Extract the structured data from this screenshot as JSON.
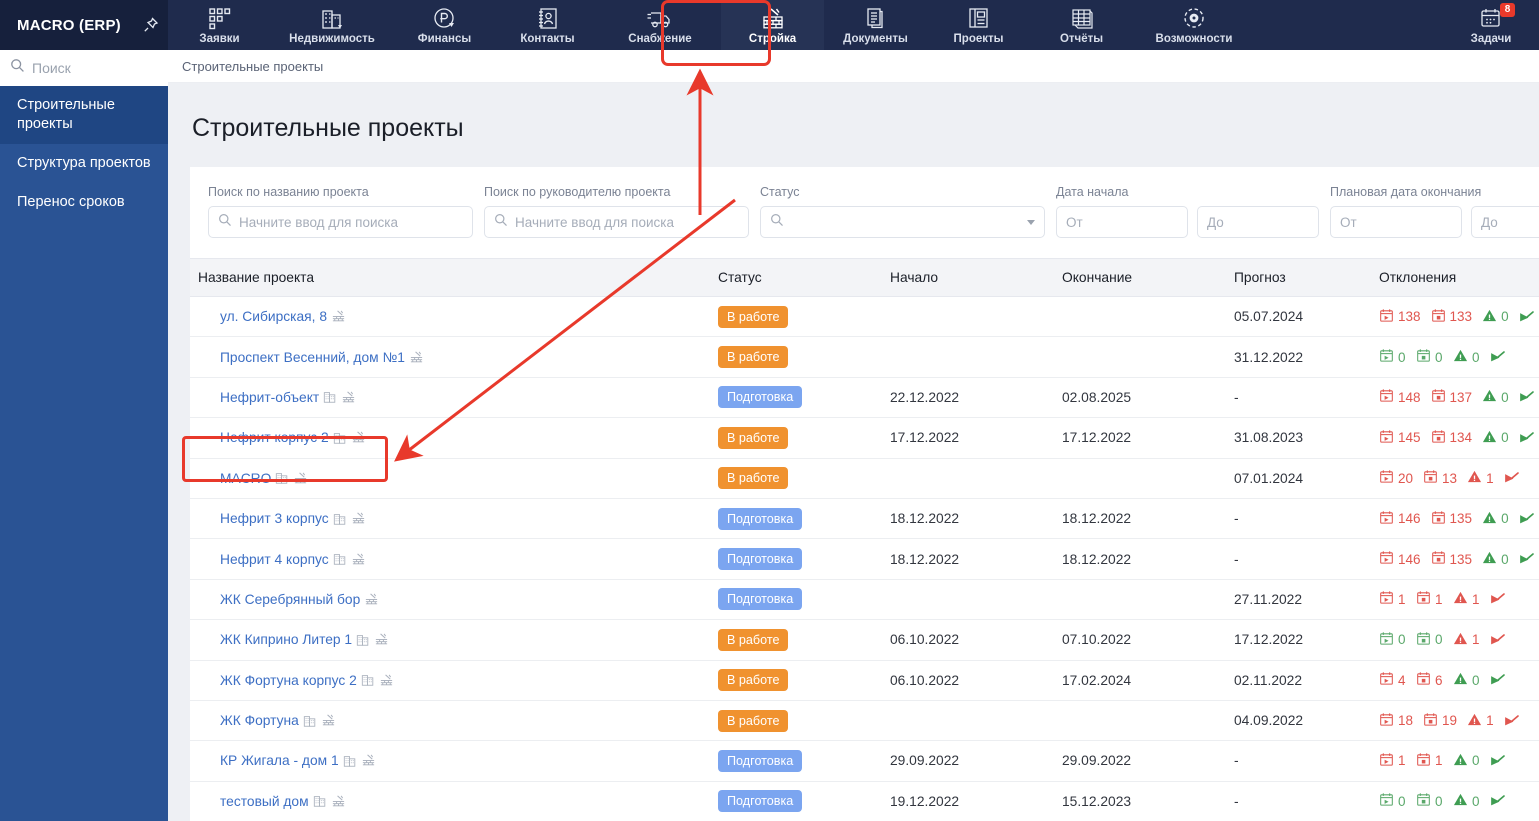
{
  "brand": {
    "title": "MACRO (ERP)",
    "pin_icon": "pin-icon"
  },
  "topnav": {
    "items": [
      {
        "label": "Заявки",
        "icon": "requests-icon"
      },
      {
        "label": "Недвижимость",
        "icon": "realestate-icon"
      },
      {
        "label": "Финансы",
        "icon": "finance-ruble-icon"
      },
      {
        "label": "Контакты",
        "icon": "contacts-icon"
      },
      {
        "label": "Снабжение",
        "icon": "supply-truck-icon"
      },
      {
        "label": "Стройка",
        "icon": "construction-icon",
        "active": true
      },
      {
        "label": "Документы",
        "icon": "documents-icon"
      },
      {
        "label": "Проекты",
        "icon": "projects-icon"
      },
      {
        "label": "Отчёты",
        "icon": "reports-icon"
      },
      {
        "label": "Возможности",
        "icon": "features-gear-icon"
      }
    ],
    "tasks": {
      "label": "Задачи",
      "icon": "calendar-tasks-icon",
      "badge": "8"
    }
  },
  "sidebar": {
    "search_placeholder": "Поиск",
    "items": [
      {
        "label": "Строительные проекты",
        "active": true
      },
      {
        "label": "Структура проектов",
        "active": false
      },
      {
        "label": "Перенос сроков",
        "active": false
      }
    ]
  },
  "breadcrumb": "Строительные проекты",
  "page_title": "Строительные проекты",
  "filters": [
    {
      "label": "Поиск по названию проекта",
      "placeholder": "Начните ввод для поиска",
      "icon": "search-icon"
    },
    {
      "label": "Поиск по руководителю проекта",
      "placeholder": "Начните ввод для поиска",
      "icon": "search-icon"
    },
    {
      "label": "Статус",
      "placeholder": "",
      "icon": "search-icon",
      "dropdown": true
    },
    {
      "label": "Дата начала",
      "from_placeholder": "От",
      "to_placeholder": "До"
    },
    {
      "label": "Плановая дата окончания",
      "from_placeholder": "От",
      "to_placeholder": "До"
    }
  ],
  "table": {
    "columns": [
      "Название проекта",
      "Статус",
      "Начало",
      "Окончание",
      "Прогноз",
      "Отклонения"
    ],
    "rows": [
      {
        "name": "ул. Сибирская, 8",
        "icons": [
          "crane-icon"
        ],
        "status": "В работе",
        "status_kind": "work",
        "start": "",
        "end": "",
        "forecast": "05.07.2024",
        "dev": [
          {
            "v": "138",
            "c": "red"
          },
          {
            "v": "133",
            "c": "red"
          },
          {
            "v": "0",
            "c": "green"
          }
        ]
      },
      {
        "name": "Проспект Весенний, дом №1",
        "icons": [
          "crane-icon"
        ],
        "status": "В работе",
        "status_kind": "work",
        "start": "",
        "end": "",
        "forecast": "31.12.2022",
        "dev": [
          {
            "v": "0",
            "c": "green"
          },
          {
            "v": "0",
            "c": "green"
          },
          {
            "v": "0",
            "c": "green"
          }
        ]
      },
      {
        "name": "Нефрит-объект",
        "icons": [
          "building-icon",
          "crane-icon"
        ],
        "status": "Подготовка",
        "status_kind": "prep",
        "start": "22.12.2022",
        "end": "02.08.2025",
        "forecast": "-",
        "dev": [
          {
            "v": "148",
            "c": "red"
          },
          {
            "v": "137",
            "c": "red"
          },
          {
            "v": "0",
            "c": "green"
          }
        ]
      },
      {
        "name": "Нефрит корпус 2",
        "icons": [
          "building-icon",
          "crane-icon"
        ],
        "status": "В работе",
        "status_kind": "work",
        "start": "17.12.2022",
        "end": "17.12.2022",
        "forecast": "31.08.2023",
        "dev": [
          {
            "v": "145",
            "c": "red"
          },
          {
            "v": "134",
            "c": "red"
          },
          {
            "v": "0",
            "c": "green"
          }
        ]
      },
      {
        "name": "MACRO",
        "icons": [
          "building-icon",
          "crane-icon"
        ],
        "status": "В работе",
        "status_kind": "work",
        "start": "",
        "end": "",
        "forecast": "07.01.2024",
        "dev": [
          {
            "v": "20",
            "c": "red"
          },
          {
            "v": "13",
            "c": "red"
          },
          {
            "v": "1",
            "c": "red"
          }
        ]
      },
      {
        "name": "Нефрит 3 корпус",
        "icons": [
          "building-icon",
          "crane-icon"
        ],
        "status": "Подготовка",
        "status_kind": "prep",
        "start": "18.12.2022",
        "end": "18.12.2022",
        "forecast": "-",
        "dev": [
          {
            "v": "146",
            "c": "red"
          },
          {
            "v": "135",
            "c": "red"
          },
          {
            "v": "0",
            "c": "green"
          }
        ]
      },
      {
        "name": "Нефрит 4 корпус",
        "icons": [
          "building-icon",
          "crane-icon"
        ],
        "status": "Подготовка",
        "status_kind": "prep",
        "start": "18.12.2022",
        "end": "18.12.2022",
        "forecast": "-",
        "dev": [
          {
            "v": "146",
            "c": "red"
          },
          {
            "v": "135",
            "c": "red"
          },
          {
            "v": "0",
            "c": "green"
          }
        ]
      },
      {
        "name": "ЖК Серебрянный бор",
        "icons": [
          "crane-icon"
        ],
        "status": "Подготовка",
        "status_kind": "prep",
        "start": "",
        "end": "",
        "forecast": "27.11.2022",
        "dev": [
          {
            "v": "1",
            "c": "red"
          },
          {
            "v": "1",
            "c": "red"
          },
          {
            "v": "1",
            "c": "red"
          }
        ]
      },
      {
        "name": "ЖК Киприно Литер 1",
        "icons": [
          "building-icon",
          "crane-icon"
        ],
        "status": "В работе",
        "status_kind": "work",
        "start": "06.10.2022",
        "end": "07.10.2022",
        "forecast": "17.12.2022",
        "dev": [
          {
            "v": "0",
            "c": "green"
          },
          {
            "v": "0",
            "c": "green"
          },
          {
            "v": "1",
            "c": "red"
          }
        ]
      },
      {
        "name": "ЖК Фортуна корпус 2",
        "icons": [
          "building-icon",
          "crane-icon"
        ],
        "status": "В работе",
        "status_kind": "work",
        "start": "06.10.2022",
        "end": "17.02.2024",
        "forecast": "02.11.2022",
        "dev": [
          {
            "v": "4",
            "c": "red"
          },
          {
            "v": "6",
            "c": "red"
          },
          {
            "v": "0",
            "c": "green"
          }
        ]
      },
      {
        "name": "ЖК Фортуна",
        "icons": [
          "building-icon",
          "crane-icon"
        ],
        "status": "В работе",
        "status_kind": "work",
        "start": "",
        "end": "",
        "forecast": "04.09.2022",
        "dev": [
          {
            "v": "18",
            "c": "red"
          },
          {
            "v": "19",
            "c": "red"
          },
          {
            "v": "1",
            "c": "red"
          }
        ]
      },
      {
        "name": "КР Жигала - дом 1",
        "icons": [
          "building-icon",
          "crane-icon"
        ],
        "status": "Подготовка",
        "status_kind": "prep",
        "start": "29.09.2022",
        "end": "29.09.2022",
        "forecast": "-",
        "dev": [
          {
            "v": "1",
            "c": "red"
          },
          {
            "v": "1",
            "c": "red"
          },
          {
            "v": "0",
            "c": "green"
          }
        ]
      },
      {
        "name": "тестовый дом",
        "icons": [
          "building-icon",
          "crane-icon"
        ],
        "status": "Подготовка",
        "status_kind": "prep",
        "start": "19.12.2022",
        "end": "15.12.2023",
        "forecast": "-",
        "dev": [
          {
            "v": "0",
            "c": "green"
          },
          {
            "v": "0",
            "c": "green"
          },
          {
            "v": "0",
            "c": "green"
          }
        ]
      }
    ]
  },
  "annotations": {
    "highlight_color": "#e8392b",
    "boxes": [
      "construction-nav-item",
      "macro-project-row"
    ],
    "arrows": [
      "arrow-to-construction-tab",
      "arrow-to-macro-row"
    ]
  }
}
